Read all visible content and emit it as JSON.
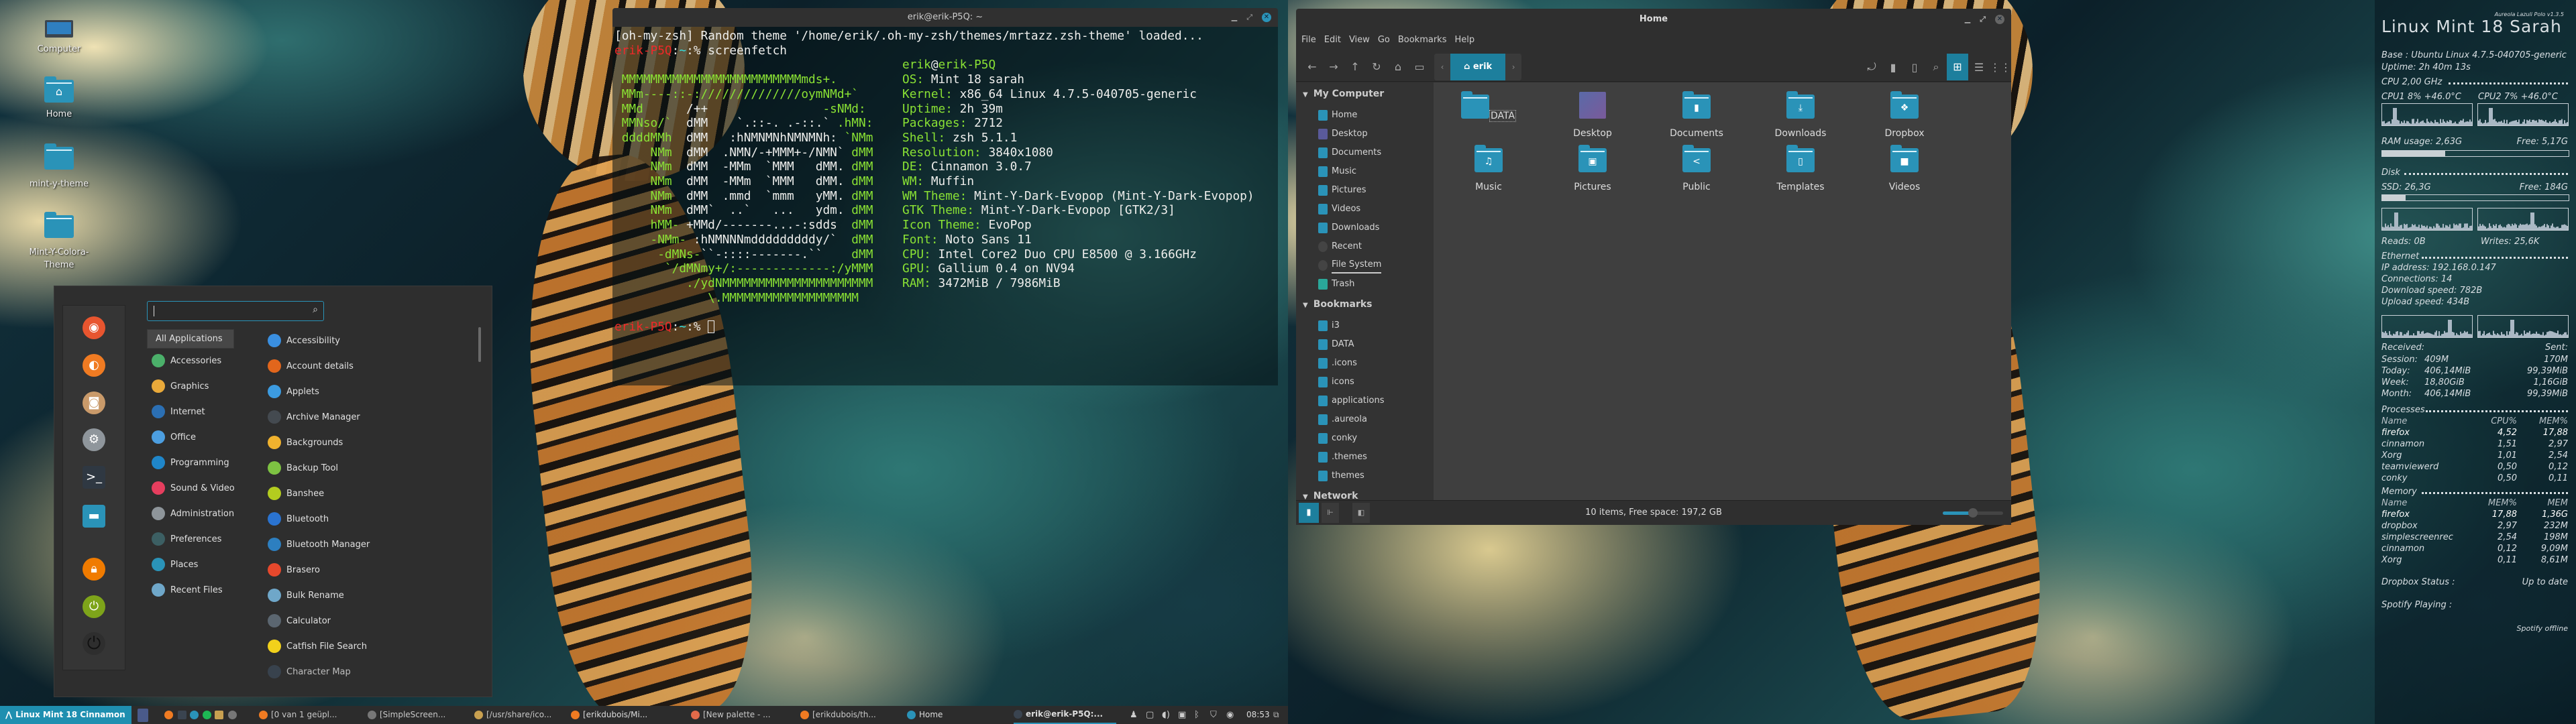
{
  "colors": {
    "accent": "#2a93b8",
    "terminal_green": "#8ae234",
    "prompt_red": "#ef2929",
    "panel": "#2c2c2c"
  },
  "desktop": {
    "icons": [
      {
        "label": "Computer",
        "icon": "laptop-icon"
      },
      {
        "label": "Home",
        "icon": "home-folder-icon"
      },
      {
        "label": "mint-y-theme",
        "icon": "folder-icon"
      },
      {
        "label": "Mint-Y-Colora-Theme",
        "icon": "folder-icon"
      }
    ]
  },
  "terminal": {
    "title": "erik@erik-P5Q: ~",
    "theme_line": "[oh-my-zsh] Random theme '/home/erik/.oh-my-zsh/themes/mrtazz.zsh-theme' loaded...",
    "prompt": {
      "host": "erik-P5Q",
      "sep": ":",
      "cwd": "~",
      "sym": ":%"
    },
    "command": "screenfetch",
    "user": "erik",
    "at": "@",
    "host": "erik-P5Q",
    "ascii": [
      [
        [
          " MMMMMMMMMMMMMMMMMMMMMMMMMmds+.",
          "g"
        ]
      ],
      [
        [
          " MMm----::-://////////////oymNMd+`",
          "g"
        ]
      ],
      [
        [
          " MMd",
          "g"
        ],
        [
          "      /++",
          "w"
        ],
        [
          "                -sNMd:",
          "g"
        ]
      ],
      [
        [
          " MMNso/`",
          "g"
        ],
        [
          "  dMM    `.::-. .-::.`",
          "w"
        ],
        [
          " .hMN:",
          "g"
        ]
      ],
      [
        [
          " ddddMMh",
          "g"
        ],
        [
          "  dMM   :hNMNMNhNMNMNh:",
          "w"
        ],
        [
          " `NMm",
          "g"
        ]
      ],
      [
        [
          "     NMm",
          "g"
        ],
        [
          "  dMM  .NMN/-+MMM+-/NMN`",
          "w"
        ],
        [
          " dMM",
          "g"
        ]
      ],
      [
        [
          "     NMm",
          "g"
        ],
        [
          "  dMM  -MMm  `MMM   dMM.",
          "w"
        ],
        [
          " dMM",
          "g"
        ]
      ],
      [
        [
          "     NMm",
          "g"
        ],
        [
          "  dMM  -MMm  `MMM   dMM.",
          "w"
        ],
        [
          " dMM",
          "g"
        ]
      ],
      [
        [
          "     NMm",
          "g"
        ],
        [
          "  dMM  .mmd  `mmm   yMM.",
          "w"
        ],
        [
          " dMM",
          "g"
        ]
      ],
      [
        [
          "     NMm",
          "g"
        ],
        [
          "  dMM`  ..`   ...   ydm.",
          "w"
        ],
        [
          " dMM",
          "g"
        ]
      ],
      [
        [
          "     hMM-",
          "g"
        ],
        [
          " +MMd/-------...-:sdds",
          "w"
        ],
        [
          "  dMM",
          "g"
        ]
      ],
      [
        [
          "     -NMm-",
          "g"
        ],
        [
          " :hNMNNNmdddddddddy/`",
          "w"
        ],
        [
          "  dMM",
          "g"
        ]
      ],
      [
        [
          "      -dMNs-",
          "g"
        ],
        [
          "``-::::-------.``",
          "w"
        ],
        [
          "    dMM",
          "g"
        ]
      ],
      [
        [
          "       `/dMNmy+/:-------------:/yMMM",
          "g"
        ]
      ],
      [
        [
          "          ./ydNMMMMMMMMMMMMMMMMMMMMM",
          "g"
        ]
      ],
      [
        [
          "             \\.MMMMMMMMMMMMMMMMMMM",
          "g"
        ]
      ]
    ],
    "info": [
      {
        "label": "OS:",
        "value": "Mint 18 sarah"
      },
      {
        "label": "Kernel:",
        "value": "x86_64 Linux 4.7.5-040705-generic"
      },
      {
        "label": "Uptime:",
        "value": "2h 39m"
      },
      {
        "label": "Packages:",
        "value": "2712"
      },
      {
        "label": "Shell:",
        "value": "zsh 5.1.1"
      },
      {
        "label": "Resolution:",
        "value": "3840x1080"
      },
      {
        "label": "DE:",
        "value": "Cinnamon 3.0.7"
      },
      {
        "label": "WM:",
        "value": "Muffin"
      },
      {
        "label": "WM Theme:",
        "value": "Mint-Y-Dark-Evopop (Mint-Y-Dark-Evopop)"
      },
      {
        "label": "GTK Theme:",
        "value": "Mint-Y-Dark-Evopop [GTK2/3]"
      },
      {
        "label": "Icon Theme:",
        "value": "EvoPop"
      },
      {
        "label": "Font:",
        "value": "Noto Sans 11"
      },
      {
        "label": "CPU:",
        "value": "Intel Core2 Duo CPU E8500 @ 3.166GHz"
      },
      {
        "label": "GPU:",
        "value": "Gallium 0.4 on NV94"
      },
      {
        "label": "RAM:",
        "value": "3472MiB / 7986MiB"
      }
    ]
  },
  "file_manager": {
    "title": "Home",
    "menu": [
      "File",
      "Edit",
      "View",
      "Go",
      "Bookmarks",
      "Help"
    ],
    "path": "erik",
    "sections": {
      "computer": "My Computer",
      "bookmarks": "Bookmarks",
      "network": "Network"
    },
    "places": [
      {
        "label": "Home",
        "icon": "home-icon"
      },
      {
        "label": "Desktop",
        "icon": "desktop-icon"
      },
      {
        "label": "Documents",
        "icon": "documents-icon"
      },
      {
        "label": "Music",
        "icon": "music-icon"
      },
      {
        "label": "Pictures",
        "icon": "pictures-icon"
      },
      {
        "label": "Videos",
        "icon": "videos-icon"
      },
      {
        "label": "Downloads",
        "icon": "downloads-icon"
      },
      {
        "label": "Recent",
        "icon": "clock-icon"
      },
      {
        "label": "File System",
        "icon": "drive-icon"
      },
      {
        "label": "Trash",
        "icon": "trash-icon"
      }
    ],
    "bookmarks": [
      "i3",
      "DATA",
      ".icons",
      "icons",
      "applications",
      ".aureola",
      "conky",
      ".themes",
      "themes"
    ],
    "items": [
      {
        "label": "DATA",
        "glyph": ""
      },
      {
        "label": "Desktop",
        "glyph": ""
      },
      {
        "label": "Documents",
        "glyph": "▮"
      },
      {
        "label": "Downloads",
        "glyph": "⤓"
      },
      {
        "label": "Dropbox",
        "glyph": "❖"
      },
      {
        "label": "Music",
        "glyph": "♫"
      },
      {
        "label": "Pictures",
        "glyph": "▣"
      },
      {
        "label": "Public",
        "glyph": "<"
      },
      {
        "label": "Templates",
        "glyph": "▯"
      },
      {
        "label": "Videos",
        "glyph": "■"
      }
    ],
    "status": "10 items, Free space: 197,2 GB",
    "zoom_fraction": 0.5
  },
  "menu": {
    "search_value": "",
    "favorites": [
      {
        "icon": "rainbow-icon",
        "color": "#e8552f"
      },
      {
        "icon": "firefox-icon",
        "color": "#f07b22"
      },
      {
        "icon": "package-icon",
        "color": "#c99a6a"
      },
      {
        "icon": "settings-icon",
        "color": "#8f969c"
      },
      {
        "icon": "terminal-icon",
        "color": "#2f3842"
      },
      {
        "icon": "files-icon",
        "color": "#2a93b8"
      },
      {
        "icon": "lock-icon",
        "color": "#f07b00"
      },
      {
        "icon": "logout-icon",
        "color": "#7ea41a"
      },
      {
        "icon": "power-icon",
        "color": "#2e2e2e"
      }
    ],
    "categories": [
      {
        "label": "All Applications",
        "color": ""
      },
      {
        "label": "Accessories",
        "color": "#4bb06a"
      },
      {
        "label": "Graphics",
        "color": "#e9a93a"
      },
      {
        "label": "Internet",
        "color": "#2b6fb3"
      },
      {
        "label": "Office",
        "color": "#4c9ee0"
      },
      {
        "label": "Programming",
        "color": "#1f86c9"
      },
      {
        "label": "Sound & Video",
        "color": "#e63e5e"
      },
      {
        "label": "Administration",
        "color": "#8e959a"
      },
      {
        "label": "Preferences",
        "color": "#3c5f63"
      },
      {
        "label": "Places",
        "color": "#2a93b8"
      },
      {
        "label": "Recent Files",
        "color": "#6fa7c9"
      }
    ],
    "apps": [
      {
        "label": "Accessibility",
        "color": "#3a8fe0"
      },
      {
        "label": "Account details",
        "color": "#e2661c"
      },
      {
        "label": "Applets",
        "color": "#3c9be0"
      },
      {
        "label": "Archive Manager",
        "color": "#444a50"
      },
      {
        "label": "Backgrounds",
        "color": "#f0b22e"
      },
      {
        "label": "Backup Tool",
        "color": "#7dc242"
      },
      {
        "label": "Banshee",
        "color": "#b3cc1f"
      },
      {
        "label": "Bluetooth",
        "color": "#2a73d0"
      },
      {
        "label": "Bluetooth Manager",
        "color": "#2d7fc0"
      },
      {
        "label": "Brasero",
        "color": "#e6482c"
      },
      {
        "label": "Bulk Rename",
        "color": "#6fa7c9"
      },
      {
        "label": "Calculator",
        "color": "#5b6670"
      },
      {
        "label": "Catfish File Search",
        "color": "#f2d11b"
      },
      {
        "label": "Character Map",
        "color": "#3b4755"
      }
    ]
  },
  "taskbar": {
    "menu_label": "Linux Mint 18 Cinnamon",
    "launchers": [
      {
        "icon": "show-desktop-icon",
        "color": "#4a5a8a"
      },
      {
        "icon": "firefox-icon",
        "color": "#f07b22"
      },
      {
        "icon": "terminal-icon",
        "color": "#3a4450"
      },
      {
        "icon": "files-icon",
        "color": "#2a93b8"
      },
      {
        "icon": "spotify-icon",
        "color": "#1db954"
      },
      {
        "icon": "sublime-icon",
        "color": "#c8a050"
      },
      {
        "icon": "screenrecorder-icon",
        "color": "#777"
      }
    ],
    "windows": [
      {
        "label": "[0 van 1 geüpl...",
        "color": "#f07b22"
      },
      {
        "label": "[SimpleScreen...",
        "color": "#777"
      },
      {
        "label": "[/usr/share/ico...",
        "color": "#c8a050"
      },
      {
        "label": "[erikdubois/Mi...",
        "color": "#f07b22"
      },
      {
        "label": "[New palette - ...",
        "color": "#e26a4a"
      },
      {
        "label": "[erikdubois/th...",
        "color": "#f07b22"
      },
      {
        "label": "Home",
        "color": "#2a93b8"
      },
      {
        "label": "erik@erik-P5Q:...",
        "color": "#3a4450"
      }
    ],
    "tray": [
      "user-icon",
      "display-icon",
      "volume-icon",
      "image-icon",
      "bluetooth-icon",
      "shield-icon",
      "dropbox-icon"
    ],
    "clock": "08:53"
  },
  "conky": {
    "version": "Aureola Lazuli Polo v1.3.5",
    "title": "Linux  Mint  18  Sarah",
    "base": "Base : Ubuntu Linux 4.7.5-040705-generic",
    "uptime": "Uptime: 2h 40m 13s",
    "cpu_header": "CPU  2,00 GHz",
    "cpu1": "CPU1 8%  +46.0°C",
    "cpu2": "CPU2  7%  +46.0°C",
    "ram_label": "RAM usage: 2,63G",
    "ram_free": "Free: 5,17G",
    "ram_fraction": 0.337,
    "disk_header": "Disk",
    "ssd_label": "SSD: 26,3G",
    "ssd_free": "Free: 184G",
    "ssd_fraction": 0.125,
    "reads": "Reads: 0B",
    "writes": "Writes: 25,6K",
    "eth_header": "Ethernet",
    "ip": "IP address: 192.168.0.147",
    "connections": "Connections: 14",
    "download": "Download speed: 782B",
    "upload": "Upload speed: 434B",
    "received": "Received:",
    "sent": "Sent:",
    "traffic": [
      {
        "period": "Session:",
        "rx": "409M",
        "tx": "170M"
      },
      {
        "period": "Today:",
        "rx": "406,14MiB",
        "tx": "99,39MiB"
      },
      {
        "period": "Week:",
        "rx": "18,80GiB",
        "tx": "1,16GiB"
      },
      {
        "period": "Month:",
        "rx": "406,14MiB",
        "tx": "99,39MiB"
      }
    ],
    "processes_header": "Processes",
    "proc_cols": [
      "Name",
      "CPU%",
      "MEM%"
    ],
    "processes": [
      [
        "firefox",
        "4,52",
        "17,88"
      ],
      [
        "cinnamon",
        "1,51",
        "2,97"
      ],
      [
        "Xorg",
        "1,01",
        "2,54"
      ],
      [
        "teamviewerd",
        "0,50",
        "0,12"
      ],
      [
        "conky",
        "0,50",
        "0,11"
      ]
    ],
    "memory_header": "Memory",
    "mem_cols": [
      "Name",
      "MEM%",
      "MEM"
    ],
    "memory": [
      [
        "firefox",
        "17,88",
        "1,36G"
      ],
      [
        "dropbox",
        "2,97",
        "232M"
      ],
      [
        "simplescreenrec",
        "2,54",
        "198M"
      ],
      [
        "cinnamon",
        "0,12",
        "9,09M"
      ],
      [
        "Xorg",
        "0,11",
        "8,61M"
      ]
    ],
    "dropbox_label": "Dropbox Status :",
    "dropbox_status": "Up to date",
    "spotify_label": "Spotify Playing :",
    "spotify_status": "Spotify offline"
  }
}
